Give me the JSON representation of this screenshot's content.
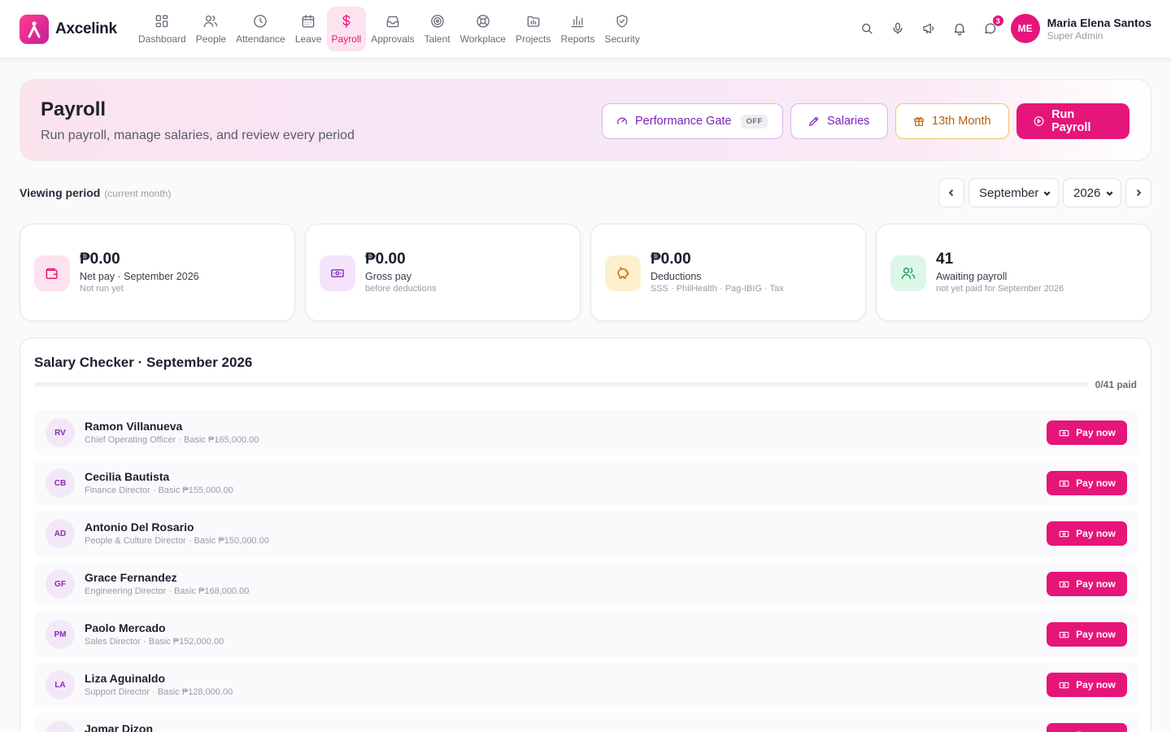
{
  "app": {
    "name": "Axcelink"
  },
  "nav": [
    {
      "label": "Dashboard",
      "icon": "dashboard-icon"
    },
    {
      "label": "People",
      "icon": "people-icon"
    },
    {
      "label": "Attendance",
      "icon": "clock-icon"
    },
    {
      "label": "Leave",
      "icon": "calendar-icon"
    },
    {
      "label": "Payroll",
      "icon": "dollar-icon",
      "active": true
    },
    {
      "label": "Approvals",
      "icon": "inbox-icon"
    },
    {
      "label": "Talent",
      "icon": "target-icon"
    },
    {
      "label": "Workplace",
      "icon": "lifebuoy-icon"
    },
    {
      "label": "Projects",
      "icon": "folder-icon"
    },
    {
      "label": "Reports",
      "icon": "bar-chart-icon"
    },
    {
      "label": "Security",
      "icon": "shield-icon"
    }
  ],
  "topbar": {
    "chat_badge": "3",
    "user": {
      "initials": "ME",
      "name": "Maria Elena Santos",
      "role": "Super Admin"
    }
  },
  "header": {
    "title": "Payroll",
    "subtitle": "Run payroll, manage salaries, and review every period",
    "performance_gate_label": "Performance Gate",
    "performance_gate_status": "OFF",
    "salaries_label": "Salaries",
    "thirteenth_label": "13th Month",
    "run_payroll_label": "Run Payroll"
  },
  "period": {
    "label": "Viewing period",
    "hint": "(current month)",
    "month": "September",
    "year": "2026"
  },
  "stats": [
    {
      "value": "₱0.00",
      "label": "Net pay · September 2026",
      "sub": "Not run yet",
      "icon": "wallet-icon",
      "color": "#e6157a",
      "bg": "#fde2ef"
    },
    {
      "value": "₱0.00",
      "label": "Gross pay",
      "sub": "before deductions",
      "icon": "cash-icon",
      "color": "#8a2ab8",
      "bg": "#f3e4fb"
    },
    {
      "value": "₱0.00",
      "label": "Deductions",
      "sub": "SSS · PhilHealth · Pag-IBIG · Tax",
      "icon": "piggy-bank-icon",
      "color": "#c0660f",
      "bg": "#fdf0cc"
    },
    {
      "value": "41",
      "label": "Awaiting payroll",
      "sub": "not yet paid for September 2026",
      "icon": "users-icon",
      "color": "#1e9e5a",
      "bg": "#ddf6e8"
    }
  ],
  "checker": {
    "title": "Salary Checker · September 2026",
    "progress_text": "0/41 paid",
    "progress_fraction": 0,
    "pay_label": "Pay now",
    "employees": [
      {
        "initials": "RV",
        "name": "Ramon Villanueva",
        "detail": "Chief Operating Officer · Basic ₱165,000.00"
      },
      {
        "initials": "CB",
        "name": "Cecilia Bautista",
        "detail": "Finance Director · Basic ₱155,000.00"
      },
      {
        "initials": "AD",
        "name": "Antonio Del Rosario",
        "detail": "People & Culture Director · Basic ₱150,000.00"
      },
      {
        "initials": "GF",
        "name": "Grace Fernandez",
        "detail": "Engineering Director · Basic ₱168,000.00"
      },
      {
        "initials": "PM",
        "name": "Paolo Mercado",
        "detail": "Sales Director · Basic ₱152,000.00"
      },
      {
        "initials": "LA",
        "name": "Liza Aguinaldo",
        "detail": "Support Director · Basic ₱128,000.00"
      },
      {
        "initials": "JD",
        "name": "Jomar Dizon",
        "detail": ""
      }
    ]
  }
}
